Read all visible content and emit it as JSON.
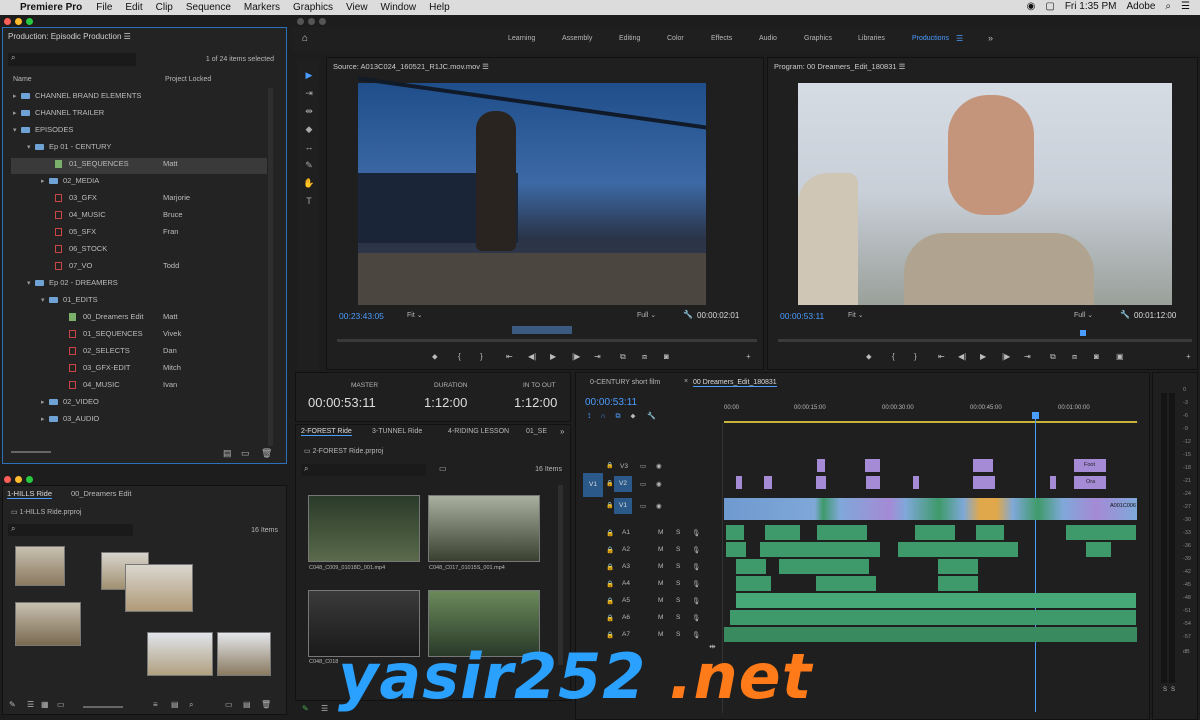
{
  "menubar": {
    "app": "Premiere Pro",
    "items": [
      "File",
      "Edit",
      "Clip",
      "Sequence",
      "Markers",
      "Graphics",
      "View",
      "Window",
      "Help"
    ],
    "time": "Fri 1:35 PM",
    "user": "Adobe"
  },
  "workspaces": [
    "Learning",
    "Assembly",
    "Editing",
    "Color",
    "Effects",
    "Audio",
    "Graphics",
    "Libraries",
    "Productions"
  ],
  "project": {
    "title": "Production: Episodic Production",
    "selected": "1 of 24 items selected",
    "col_name": "Name",
    "col_lock": "Project Locked",
    "rows": [
      {
        "label": "CHANNEL BRAND ELEMENTS",
        "lock": ""
      },
      {
        "label": "CHANNEL TRAILER",
        "lock": ""
      },
      {
        "label": "EPISODES",
        "lock": ""
      },
      {
        "label": "Ep 01 - CENTURY",
        "lock": ""
      },
      {
        "label": "01_SEQUENCES",
        "lock": "Matt"
      },
      {
        "label": "02_MEDIA",
        "lock": ""
      },
      {
        "label": "03_GFX",
        "lock": "Marjorie"
      },
      {
        "label": "04_MUSIC",
        "lock": "Bruce"
      },
      {
        "label": "05_SFX",
        "lock": "Fran"
      },
      {
        "label": "06_STOCK",
        "lock": ""
      },
      {
        "label": "07_VO",
        "lock": "Todd"
      },
      {
        "label": "Ep 02 - DREAMERS",
        "lock": ""
      },
      {
        "label": "01_EDITS",
        "lock": ""
      },
      {
        "label": "00_Dreamers Edit",
        "lock": "Matt"
      },
      {
        "label": "01_SEQUENCES",
        "lock": "Vivek"
      },
      {
        "label": "02_SELECTS",
        "lock": "Dan"
      },
      {
        "label": "03_GFX-EDIT",
        "lock": "Mitch"
      },
      {
        "label": "04_MUSIC",
        "lock": "Ivan"
      },
      {
        "label": "02_VIDEO",
        "lock": ""
      },
      {
        "label": "03_AUDIO",
        "lock": ""
      }
    ]
  },
  "bin1": {
    "tab1": "1-HILLS Ride",
    "tab2": "00_Dreamers Edit",
    "path": "1-HILLS Ride.prproj",
    "items": "16 Items"
  },
  "source": {
    "title": "Source: A013C024_160521_R1JC.mov.mov",
    "tc": "00:23:43:05",
    "fit": "Fit",
    "full": "Full",
    "dur": "00:00:02:01"
  },
  "program": {
    "title": "Program: 00 Dreamers_Edit_180831",
    "tc": "00:00:53:11",
    "fit": "Fit",
    "full": "Full",
    "dur": "00:01:12:00"
  },
  "info": {
    "master_lbl": "MASTER",
    "master": "00:00:53:11",
    "dur_lbl": "DURATION",
    "dur": "1:12:00",
    "io_lbl": "IN TO OUT",
    "io": "1:12:00"
  },
  "bin2": {
    "tabs": [
      "2-FOREST Ride",
      "3-TUNNEL Ride",
      "4-RIDING LESSON",
      "01_SE"
    ],
    "path": "2-FOREST Ride.prproj",
    "items": "16 Items",
    "clips": [
      "C048_C009_01018D_001.mp4",
      "C048_C017_01015S_001.mp4",
      "C048_C018",
      ""
    ]
  },
  "timeline": {
    "tabs": [
      "0-CENTURY short film",
      "00 Dreamers_Edit_180831"
    ],
    "tc": "00:00:53:11",
    "ruler": [
      "00:00",
      "00:00:15:00",
      "00:00:30:00",
      "00:00:45:00",
      "00:01:00:00"
    ],
    "vtracks": [
      "V3",
      "V2",
      "V1"
    ],
    "atracks": [
      "A1",
      "A2",
      "A3",
      "A4",
      "A5",
      "A6",
      "A7"
    ],
    "src_v": "V1",
    "clip_labels": [
      "Foot",
      "Ora",
      "A001C006"
    ]
  },
  "meter": [
    "0",
    "-3",
    "-6",
    "-9",
    "-12",
    "-15",
    "-18",
    "-21",
    "-24",
    "-27",
    "-30",
    "-33",
    "-36",
    "-39",
    "-42",
    "-45",
    "-48",
    "-51",
    "-54",
    "-57",
    "dB"
  ],
  "watermark": {
    "a": "yasir252",
    "b": " .net"
  },
  "colors": {
    "accent": "#4b9cff",
    "video": "#7fa8d8",
    "audio": "#3e9a6a",
    "graphic": "#a58ad6"
  }
}
